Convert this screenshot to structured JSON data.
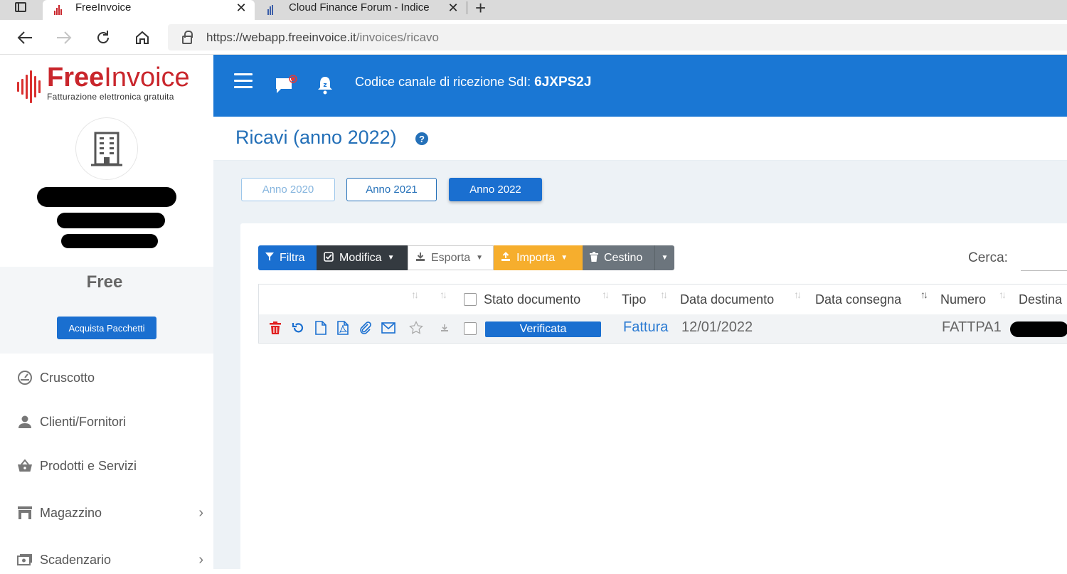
{
  "browser": {
    "tabs": [
      {
        "title": "FreeInvoice",
        "active": true
      },
      {
        "title": "Cloud Finance Forum - Indice",
        "active": false
      }
    ],
    "url_host": "https://webapp.freeinvoice.it",
    "url_path": "/invoices/ricavo",
    "new_tab_glyph": "+",
    "close_glyph": "✕"
  },
  "brand": {
    "name_bold": "Free",
    "name_light": "Invoice",
    "tagline": "Fatturazione elettronica gratuita",
    "color": "#c9262c"
  },
  "account": {
    "plan": "Free",
    "buy_label": "Acquista Pacchetti"
  },
  "sidebar": {
    "items": [
      {
        "label": "Cruscotto",
        "icon": "gauge-icon"
      },
      {
        "label": "Clienti/Fornitori",
        "icon": "user-icon"
      },
      {
        "label": "Prodotti e Servizi",
        "icon": "basket-icon"
      },
      {
        "label": "Magazzino",
        "icon": "warehouse-icon",
        "chevron": "›"
      },
      {
        "label": "Scadenzario",
        "icon": "money-icon",
        "chevron": "›"
      }
    ]
  },
  "header": {
    "sdi_label": "Codice canale di ricezione SdI:",
    "sdi_code": "6JXPS2J",
    "bg_color": "#1a77d4"
  },
  "page": {
    "title": "Ricavi (anno 2022)",
    "help_glyph": "?"
  },
  "years": {
    "y2020": "Anno 2020",
    "y2021": "Anno 2021",
    "y2022": "Anno 2022",
    "selected": "Anno 2022"
  },
  "toolbar": {
    "filtra": "Filtra",
    "modifica": "Modifica",
    "esporta": "Esporta",
    "importa": "Importa",
    "cestino": "Cestino",
    "search_label": "Cerca:",
    "search_value": ""
  },
  "table": {
    "columns": [
      "Stato documento",
      "Tipo",
      "Data documento",
      "Data consegna",
      "Numero",
      "Destina"
    ],
    "rows": [
      {
        "stato": "Verificata",
        "tipo": "Fattura",
        "data_documento": "12/01/2022",
        "data_consegna": "",
        "numero": "FATTPA1"
      }
    ]
  }
}
